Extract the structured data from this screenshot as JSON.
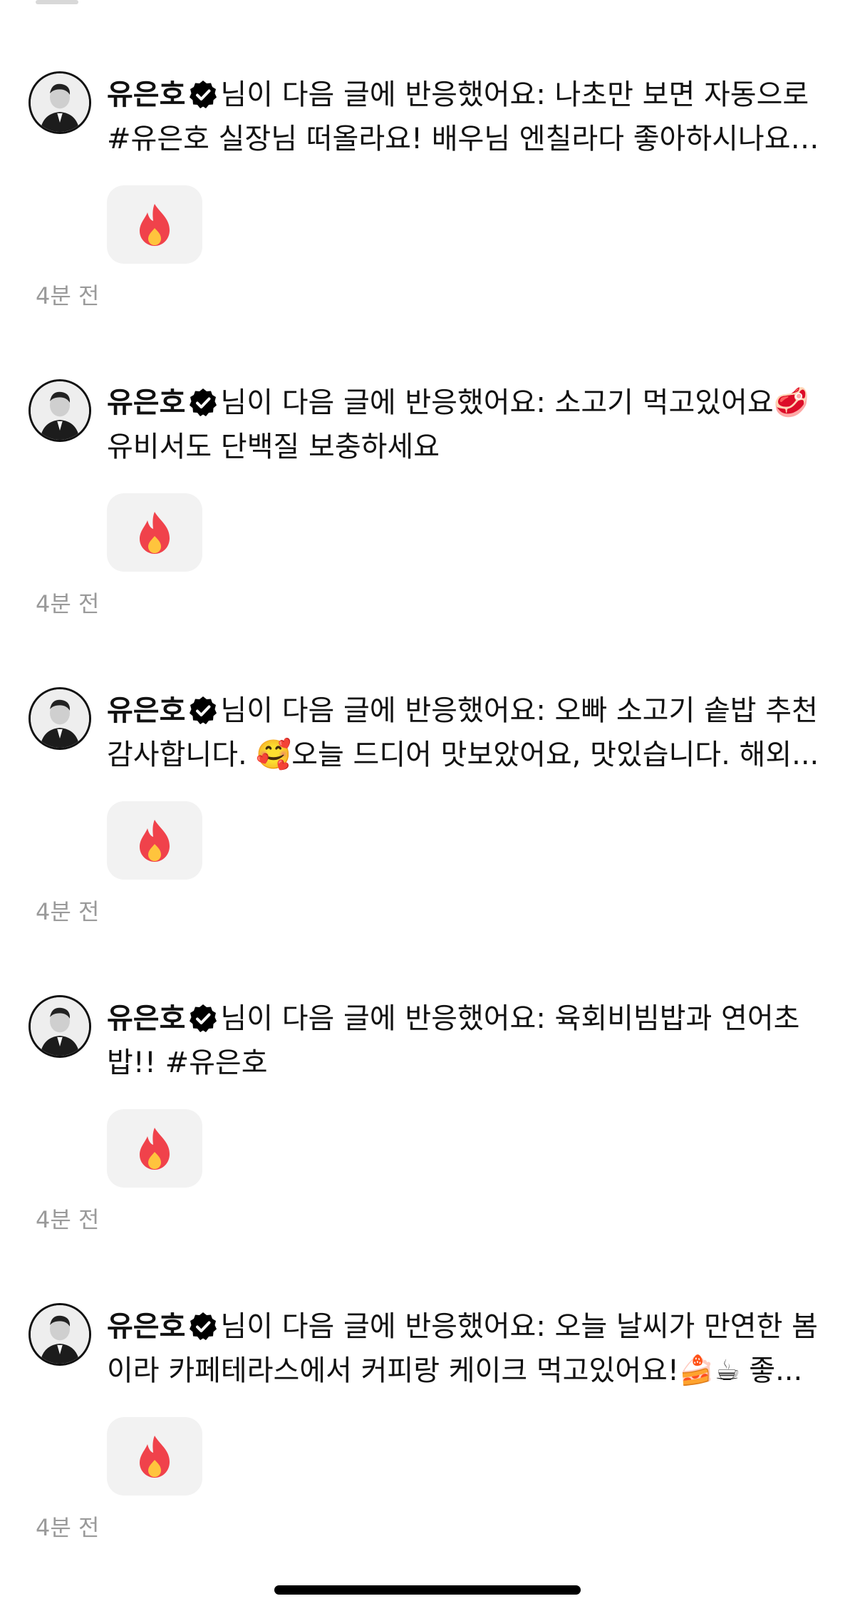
{
  "notifications": [
    {
      "name": "유은호",
      "line1": "님이 다음 글에 반응했어요: 나초만 보면 자동으로",
      "line2": "#유은호 실장님 떠올라요! 배우님 엔칠라다 좋아하시나요~...",
      "reaction_icon": "fire-icon",
      "time": "4분 전"
    },
    {
      "name": "유은호",
      "line1": "님이 다음 글에 반응했어요: 소고기 먹고있어요🥩",
      "line2": "유비서도 단백질 보충하세요",
      "reaction_icon": "fire-icon",
      "time": "4분 전"
    },
    {
      "name": "유은호",
      "line1": "님이 다음 글에 반응했어요: 오빠 소고기 솥밥 추천",
      "line2": "감사합니다. 🥰오늘 드디어 맛보았어요, 맛있습니다. 해외...",
      "reaction_icon": "fire-icon",
      "time": "4분 전"
    },
    {
      "name": "유은호",
      "line1": "님이 다음 글에 반응했어요: 육회비빔밥과 연어초",
      "line2": "밥!! #유은호",
      "reaction_icon": "fire-icon",
      "time": "4분 전"
    },
    {
      "name": "유은호",
      "line1": "님이 다음 글에 반응했어요: 오늘 날씨가 만연한 봄",
      "line2": "이라 카페테라스에서 커피랑 케이크 먹고있어요!🍰☕ 좋...",
      "reaction_icon": "fire-icon",
      "time": "4분 전"
    }
  ],
  "colors": {
    "fire_outer": "#F0424B",
    "fire_inner": "#FFC43D",
    "chip_bg": "#F2F2F2",
    "time_gray": "#9A9A9A"
  }
}
